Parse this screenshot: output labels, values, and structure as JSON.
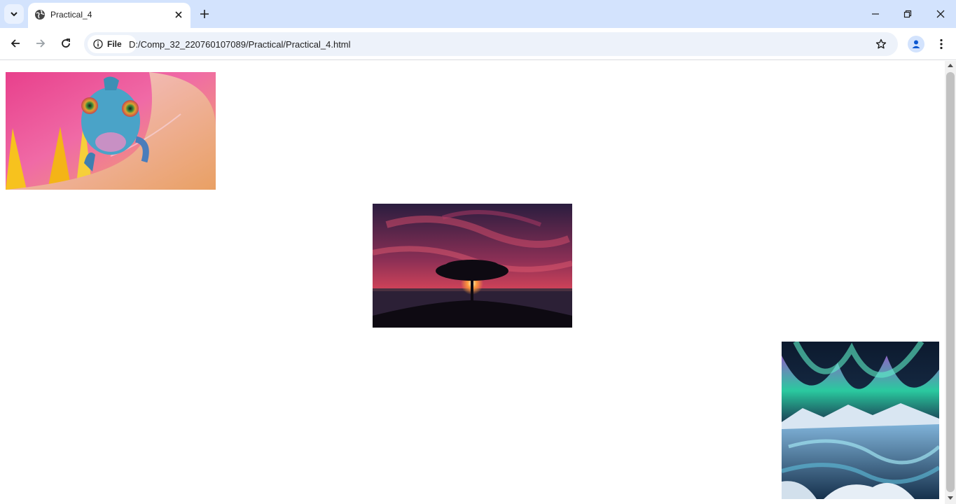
{
  "browser": {
    "tab": {
      "title": "Practical_4",
      "favicon": "globe-icon"
    },
    "address_bar": {
      "chip_label": "File",
      "chip_icon": "info-icon",
      "url": "D:/Comp_32_220760107089/Practical/Practical_4.html"
    },
    "icons": {
      "tab_search": "chevron-down-icon",
      "tab_close": "close-icon",
      "new_tab": "plus-icon",
      "minimize": "minimize-icon",
      "restore": "restore-icon",
      "close": "close-icon",
      "back": "arrow-left-icon",
      "forward": "arrow-right-icon",
      "reload": "reload-icon",
      "bookmark": "star-icon",
      "profile": "person-icon",
      "menu": "more-vertical-icon"
    }
  },
  "page": {
    "images": [
      {
        "subject": "chameleon",
        "align": "left"
      },
      {
        "subject": "tree-sunset",
        "align": "center"
      },
      {
        "subject": "aurora",
        "align": "right"
      }
    ]
  },
  "colors": {
    "tabstrip": "#d3e3fd",
    "omnibox": "#edf2fa",
    "accent": "#0b57d0"
  }
}
